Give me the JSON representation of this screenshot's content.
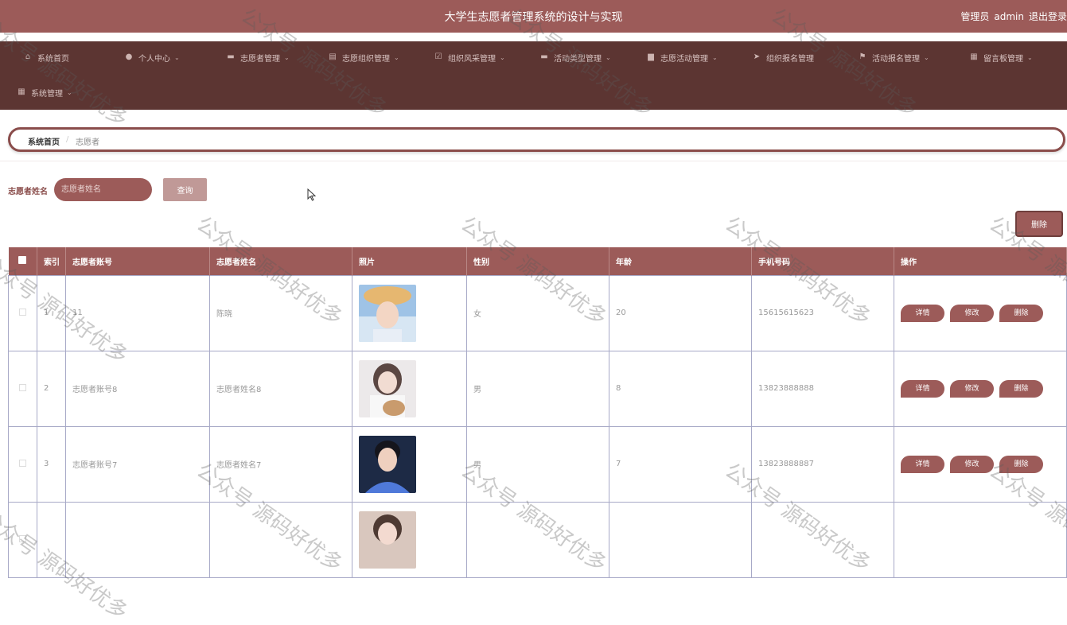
{
  "header": {
    "title": "大学生志愿者管理系统的设计与实现",
    "role": "管理员",
    "username": "admin",
    "logout_label": "退出登录"
  },
  "nav": {
    "items": [
      {
        "label": "系统首页",
        "icon": "home-icon",
        "has_dropdown": false
      },
      {
        "label": "个人中心",
        "icon": "person-icon",
        "has_dropdown": true
      },
      {
        "label": "志愿者管理",
        "icon": "id-card-icon",
        "has_dropdown": true
      },
      {
        "label": "志愿组织管理",
        "icon": "document-icon",
        "has_dropdown": true
      },
      {
        "label": "组织风采管理",
        "icon": "checkbox-icon",
        "has_dropdown": true
      },
      {
        "label": "活动类型管理",
        "icon": "chat-icon",
        "has_dropdown": true
      },
      {
        "label": "志愿活动管理",
        "icon": "briefcase-icon",
        "has_dropdown": true
      },
      {
        "label": "组织报名管理",
        "icon": "send-icon",
        "has_dropdown": false
      },
      {
        "label": "活动报名管理",
        "icon": "flag-icon",
        "has_dropdown": true
      },
      {
        "label": "留言板管理",
        "icon": "grid-icon",
        "has_dropdown": true
      },
      {
        "label": "系统管理",
        "icon": "grid-icon",
        "has_dropdown": true
      }
    ]
  },
  "breadcrumb": {
    "home": "系统首页",
    "separator": "/",
    "current": "志愿者"
  },
  "search": {
    "label": "志愿者姓名",
    "placeholder": "志愿者姓名",
    "button_label": "查询"
  },
  "toolbar": {
    "delete_label": "删除"
  },
  "table": {
    "columns": [
      "索引",
      "志愿者账号",
      "志愿者姓名",
      "照片",
      "性别",
      "年龄",
      "手机号码",
      "操作"
    ],
    "rows": [
      {
        "index": "1",
        "account": "11",
        "name": "陈晓",
        "gender": "女",
        "age": "20",
        "phone": "15615615623"
      },
      {
        "index": "2",
        "account": "志愿者账号8",
        "name": "志愿者姓名8",
        "gender": "男",
        "age": "8",
        "phone": "13823888888"
      },
      {
        "index": "3",
        "account": "志愿者账号7",
        "name": "志愿者姓名7",
        "gender": "男",
        "age": "7",
        "phone": "13823888887"
      },
      {
        "index": "",
        "account": "",
        "name": "",
        "gender": "",
        "age": "",
        "phone": ""
      }
    ],
    "actions": {
      "detail": "详情",
      "edit": "修改",
      "delete": "删除"
    }
  },
  "watermark": "公众号 源码好优多",
  "colors": {
    "header_bg": "#9c5b59",
    "nav_bg": "#5c3532",
    "accent": "#9c5b59",
    "button_light": "#c09997",
    "table_border": "#a7a9c7"
  }
}
